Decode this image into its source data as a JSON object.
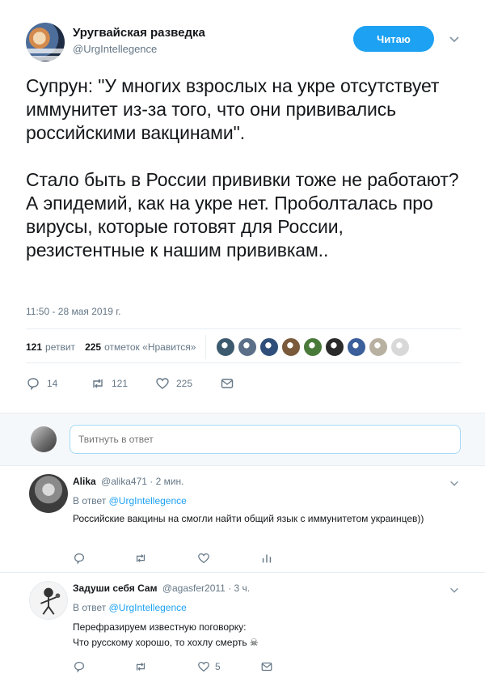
{
  "tweet": {
    "author_name": "Уругвайская разведка",
    "author_handle": "@UrgIntellegence",
    "follow_label": "Читаю",
    "text": "Супрун: \"У многих взрослых на укре отсутствует иммунитет из-за того, что они прививались российскими вакцинами\".\n\nСтало быть в России прививки тоже не работают? А эпидемий, как на укре нет. Проболталась про вирусы, которые готовят для России, резистентные к нашим прививкам..",
    "timestamp": "11:50 - 28 мая 2019 г.",
    "retweets_count": "121",
    "retweets_label": "ретвит",
    "likes_count": "225",
    "likes_label": "отметок «Нравится»",
    "likers": [
      "#3c5a6e",
      "#5b6f88",
      "#2f4f7a",
      "#7a5a3a",
      "#4a7a3a",
      "#2a2a2a",
      "#3a5f9a",
      "#b8b0a0",
      "#d8d8d8"
    ],
    "actions": {
      "replies": "14",
      "retweets": "121",
      "likes": "225"
    }
  },
  "reply_box": {
    "placeholder": "Твитнуть в ответ"
  },
  "replies": [
    {
      "name": "Alika",
      "handle": "@alika471",
      "time": "· 2 мин.",
      "in_reply_prefix": "В ответ ",
      "in_reply_to": "@UrgIntellegence",
      "text": "Российские вакцины на смогли найти общий язык с иммунитетом украинцев))",
      "likes": ""
    },
    {
      "name": "Задуши себя Сам",
      "handle": "@agasfer2011",
      "time": "· 3 ч.",
      "in_reply_prefix": "В ответ ",
      "in_reply_to": "@UrgIntellegence",
      "text": "Перефразируем известную поговорку:\nЧто русскому хорошо, то хохлу смерть ☠",
      "likes": "5"
    }
  ],
  "colors": {
    "accent": "#1da1f2",
    "muted": "#657786",
    "text": "#14171a"
  }
}
